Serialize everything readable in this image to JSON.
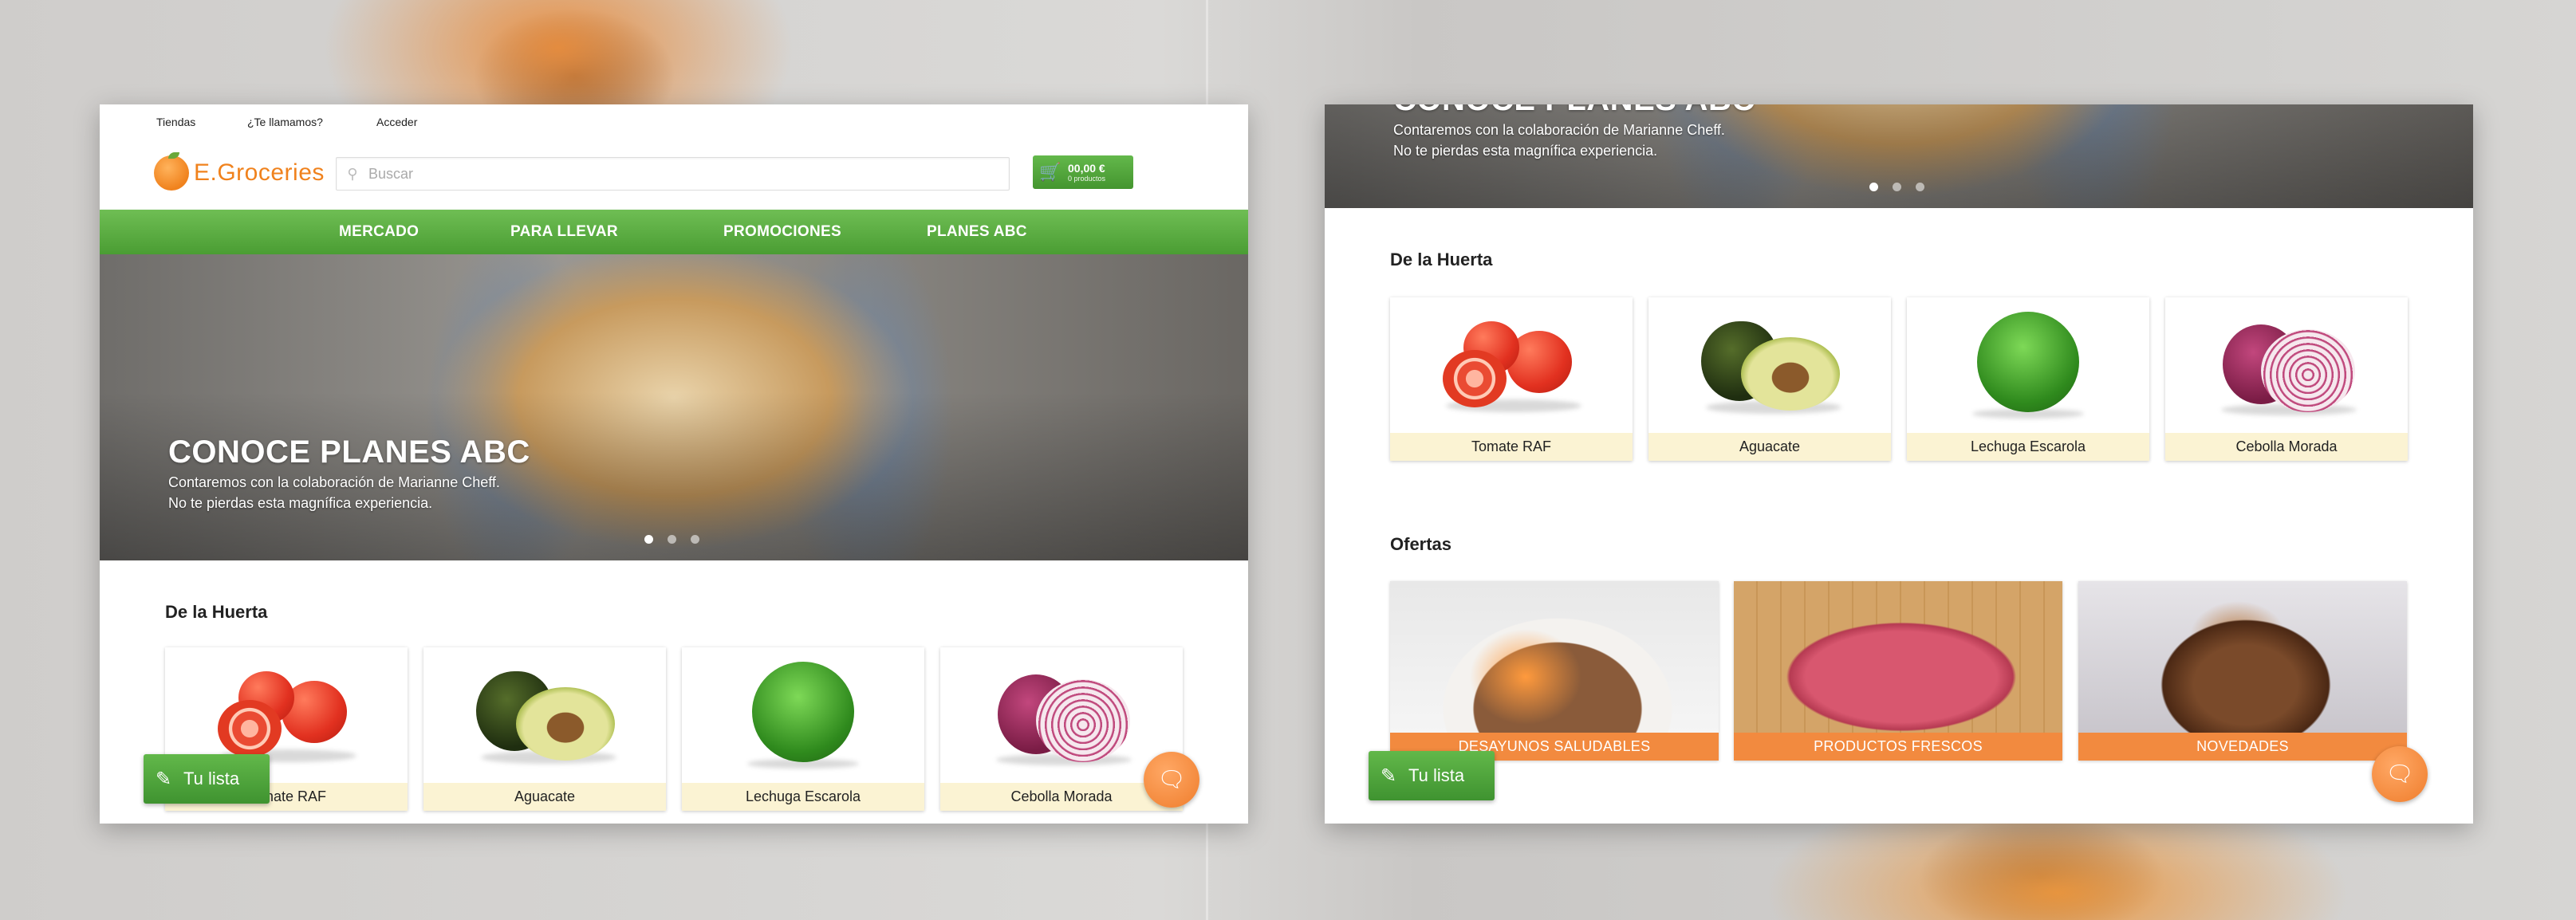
{
  "topbar": {
    "stores": "Tiendas",
    "call": "¿Te llamamos?",
    "login": "Acceder"
  },
  "brand": {
    "name": "E.Groceries"
  },
  "search": {
    "placeholder": "Buscar",
    "icon": "search-icon"
  },
  "cart": {
    "total": "00,00 €",
    "count": "0 productos",
    "icon": "cart-icon"
  },
  "nav": {
    "items": [
      "MERCADO",
      "PARA LLEVAR",
      "PROMOCIONES",
      "PLANES ABC"
    ]
  },
  "hero": {
    "title": "CONOCE PLANES ABC",
    "line1": "Contaremos con la colaboración de Marianne Cheff.",
    "line2": "No te pierdas esta magnífica experiencia.",
    "slides": 3,
    "active_slide": 1
  },
  "sections": {
    "huerta": {
      "title": "De la Huerta",
      "products": [
        "Tomate RAF",
        "Aguacate",
        "Lechuga Escarola",
        "Cebolla Morada"
      ]
    },
    "ofertas": {
      "title": "Ofertas",
      "items": [
        "DESAYUNOS SALUDABLES",
        "PRODUCTOS FRESCOS",
        "NOVEDADES"
      ]
    }
  },
  "floating": {
    "list_label": "Tu lista",
    "list_icon": "notepad-icon",
    "chat_icon": "chat-icon"
  },
  "colors": {
    "green": "#4a9d33",
    "orange": "#f0821d",
    "label_cream": "#fbf3d3",
    "offer_orange": "#f28a3f"
  }
}
